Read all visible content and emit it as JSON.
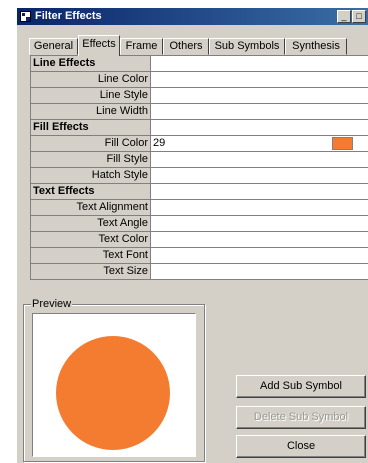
{
  "window": {
    "title": "Filter Effects",
    "title_buttons": {
      "minimize": "_",
      "maximize": "□"
    }
  },
  "tabs": [
    {
      "label": "General",
      "active": false
    },
    {
      "label": "Effects",
      "active": true
    },
    {
      "label": "Frame",
      "active": false
    },
    {
      "label": "Others",
      "active": false
    },
    {
      "label": "Sub Symbols",
      "active": false
    },
    {
      "label": "Synthesis",
      "active": false
    }
  ],
  "properties": {
    "line_effects": {
      "header": "Line Effects",
      "line_color": {
        "label": "Line Color",
        "value": ""
      },
      "line_style": {
        "label": "Line Style",
        "value": ""
      },
      "line_width": {
        "label": "Line Width",
        "value": ""
      }
    },
    "fill_effects": {
      "header": "Fill Effects",
      "fill_color": {
        "label": "Fill Color",
        "value": "29",
        "swatch_color": "#f47c30"
      },
      "fill_style": {
        "label": "Fill Style",
        "value": ""
      },
      "hatch_style": {
        "label": "Hatch Style",
        "value": ""
      }
    },
    "text_effects": {
      "header": "Text Effects",
      "text_alignment": {
        "label": "Text Alignment",
        "value": ""
      },
      "text_angle": {
        "label": "Text Angle",
        "value": ""
      },
      "text_color": {
        "label": "Text Color",
        "value": ""
      },
      "text_font": {
        "label": "Text Font",
        "value": ""
      },
      "text_size": {
        "label": "Text Size",
        "value": ""
      }
    }
  },
  "preview": {
    "label": "Preview",
    "shape_color": "#f47c30"
  },
  "buttons": {
    "add_sub_symbol": "Add Sub Symbol",
    "delete_sub_symbol": "Delete Sub Symbol",
    "close": "Close"
  }
}
